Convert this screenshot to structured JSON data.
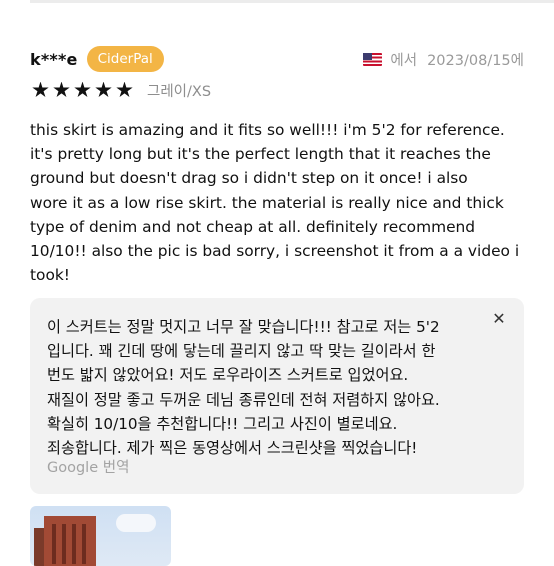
{
  "review": {
    "username": "k***e",
    "badge": "CiderPal",
    "country_flag_icon": "us-flag-icon",
    "source_suffix": "에서",
    "date": "2023/08/15에",
    "rating": 5,
    "rating_max": 5,
    "variant": "그레이/XS",
    "text": "this skirt is amazing and it fits so well!!! i'm 5'2 for reference.\nit's pretty long but it's the perfect length that it reaches the\nground but doesn't drag so i didn't step on it once!  i also\nwore it as a low rise skirt. the material is really nice and thick\ntype of denim and not cheap at all. definitely recommend\n10/10!! also the pic is bad sorry, i screenshot it from a a video i\ntook!"
  },
  "translation": {
    "text": "이 스커트는 정말 멋지고 너무 잘 맞습니다!!! 참고로 저는 5'2\n입니다. 꽤 긴데 땅에 닿는데 끌리지 않고 딱 맞는 길이라서 한\n번도 밟지 않았어요! 저도 로우라이즈 스커트로 입었어요.\n재질이 정말 좋고 두꺼운 데님 종류인데 전혀 저렴하지 않아요.\n확실히 10/10을 추천합니다!! 그리고 사진이 별로네요.\n죄송합니다. 제가 찍은 동영상에서 스크린샷을 찍었습니다!",
    "provider_label": "Google 번역",
    "close_icon": "close-icon",
    "close_symbol": "✕"
  },
  "colors": {
    "badge_bg": "#f3b545",
    "muted_text": "#9a9a9a",
    "translation_bg": "#f2f2f2"
  }
}
